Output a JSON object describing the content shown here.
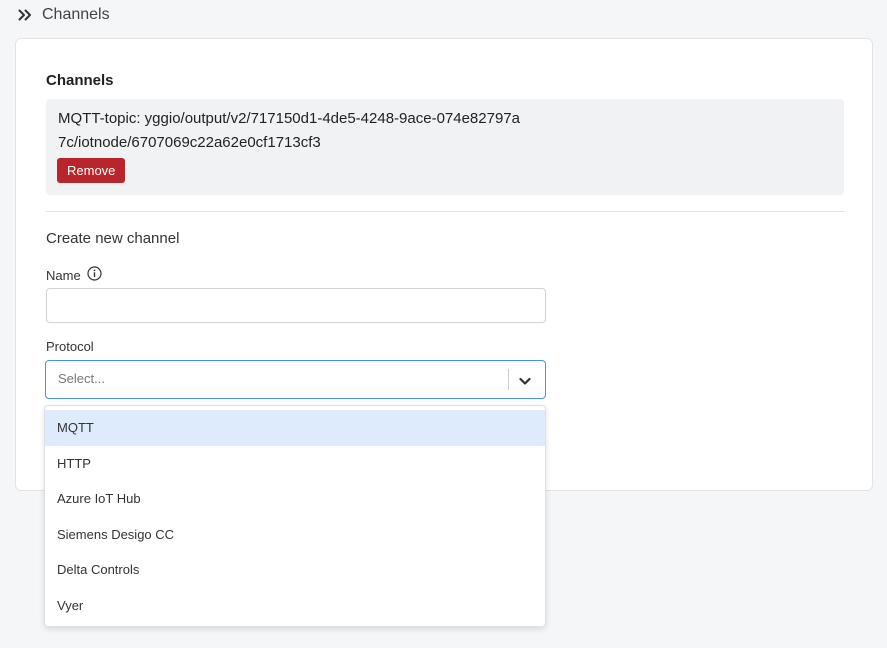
{
  "breadcrumb": {
    "icon": "double-chevron-right-icon",
    "title": "Channels"
  },
  "card": {
    "title": "Channels",
    "channel": {
      "text": "MQTT-topic: yggio/output/v2/717150d1-4de5-4248-9ace-074e82797a7c/iotnode/6707069c22a62e0cf1713cf3",
      "remove_label": "Remove"
    },
    "create": {
      "title": "Create new channel",
      "name_label": "Name",
      "name_value": "",
      "protocol_label": "Protocol",
      "protocol_placeholder": "Select..."
    }
  },
  "dropdown": {
    "options": [
      {
        "label": "MQTT",
        "highlighted": true
      },
      {
        "label": "HTTP"
      },
      {
        "label": "Azure IoT Hub"
      },
      {
        "label": "Siemens Desigo CC"
      },
      {
        "label": "Delta Controls"
      },
      {
        "label": "Vyer"
      }
    ]
  },
  "colors": {
    "accent": "#4a8ff0",
    "danger": "#b8262b",
    "option_highlight": "#deebfd"
  }
}
